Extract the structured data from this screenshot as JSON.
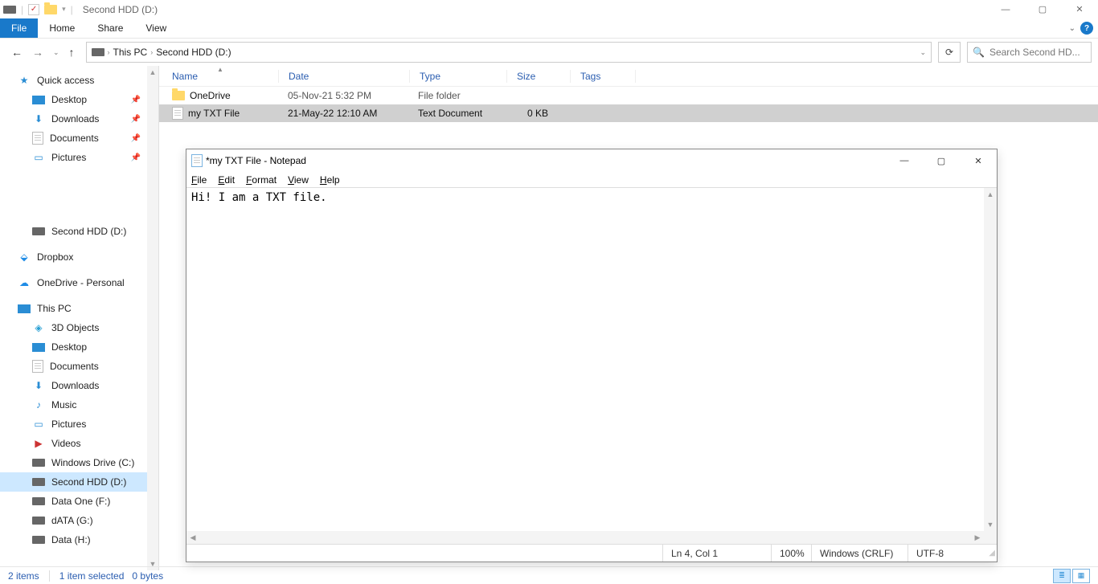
{
  "explorer": {
    "title": "Second HDD (D:)",
    "menuTabs": {
      "file": "File",
      "home": "Home",
      "share": "Share",
      "view": "View"
    },
    "breadcrumb": [
      "This PC",
      "Second HDD (D:)"
    ],
    "search": {
      "placeholder": "Search Second HD..."
    },
    "columns": {
      "name": "Name",
      "date": "Date",
      "type": "Type",
      "size": "Size",
      "tags": "Tags"
    },
    "rows": [
      {
        "name": "OneDrive",
        "date": "05-Nov-21 5:32 PM",
        "type": "File folder",
        "size": "",
        "kind": "folder",
        "selected": false
      },
      {
        "name": "my TXT File",
        "date": "21-May-22 12:10 AM",
        "type": "Text Document",
        "size": "0 KB",
        "kind": "file",
        "selected": true
      }
    ],
    "sidebar": {
      "quickAccess": "Quick access",
      "qa": [
        {
          "label": "Desktop",
          "pinned": true
        },
        {
          "label": "Downloads",
          "pinned": true
        },
        {
          "label": "Documents",
          "pinned": true
        },
        {
          "label": "Pictures",
          "pinned": true
        }
      ],
      "shortcuts": [
        {
          "label": "Second HDD (D:)"
        },
        {
          "label": "Dropbox"
        },
        {
          "label": "OneDrive - Personal"
        }
      ],
      "thisPC": "This PC",
      "pc": [
        "3D Objects",
        "Desktop",
        "Documents",
        "Downloads",
        "Music",
        "Pictures",
        "Videos",
        "Windows Drive (C:)",
        "Second HDD (D:)",
        "Data One (F:)",
        "dATA (G:)",
        "Data (H:)"
      ]
    },
    "status": {
      "items": "2 items",
      "selected": "1 item selected",
      "bytes": "0 bytes"
    }
  },
  "notepad": {
    "title": "*my TXT File - Notepad",
    "menu": [
      "File",
      "Edit",
      "Format",
      "View",
      "Help"
    ],
    "content": "Hi! I am a TXT file.",
    "status": {
      "pos": "Ln 4, Col 1",
      "zoom": "100%",
      "eol": "Windows (CRLF)",
      "enc": "UTF-8"
    }
  }
}
